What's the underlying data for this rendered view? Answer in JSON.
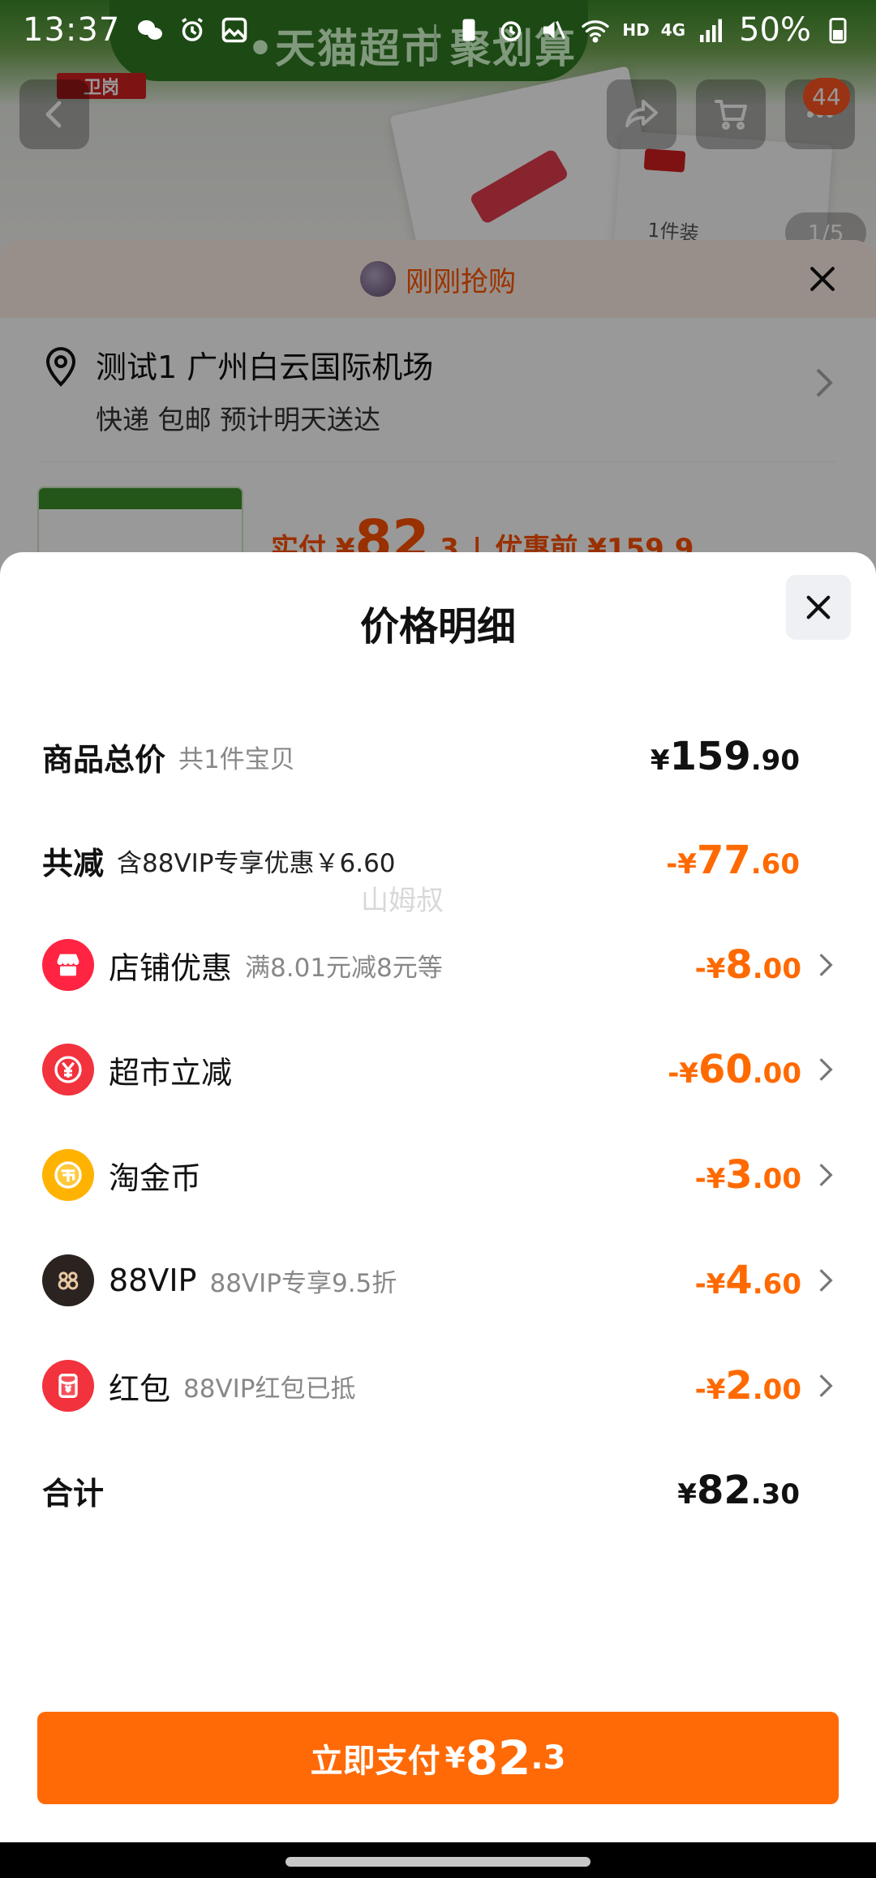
{
  "status_bar": {
    "time": "13:37",
    "hd_label": "HD",
    "network_label": "4G",
    "battery": "50%"
  },
  "background": {
    "banner_text_1": "•天猫超市",
    "banner_text_2": "聚划算",
    "brand_logo": "卫岗",
    "cart_badge": "44",
    "image_counter": "1/5",
    "product_tag": "1件装",
    "sheet": {
      "header_label": "刚刚抢购",
      "address_line": "测试1 广州白云国际机场",
      "delivery_line": "快递 包邮 预计明天送达",
      "paid_label": "实付 ¥",
      "paid_int": "82",
      "paid_dec": ".3",
      "original_label": "优惠前 ¥159.9"
    }
  },
  "modal": {
    "title": "价格明细",
    "watermark": "山姆叔",
    "rows": {
      "total": {
        "label": "商品总价",
        "sub": "共1件宝贝",
        "cur": "¥",
        "int": "159",
        "dec": ".90"
      },
      "discount": {
        "label": "共减",
        "sub": "含88VIP专享优惠￥6.60",
        "sign": "-¥",
        "int": "77",
        "dec": ".60"
      },
      "store": {
        "label": "店铺优惠",
        "sub": "满8.01元减8元等",
        "sign": "-¥",
        "int": "8",
        "dec": ".00",
        "icon": "store-icon",
        "color": "#ff2442"
      },
      "supermarket": {
        "label": "超市立减",
        "sign": "-¥",
        "int": "60",
        "dec": ".00",
        "icon": "yen-coin-icon",
        "color": "#f2323d"
      },
      "taojinbi": {
        "label": "淘金币",
        "sign": "-¥",
        "int": "3",
        "dec": ".00",
        "icon": "gold-coin-icon",
        "color": "#ffb300"
      },
      "vip": {
        "label": "88VIP",
        "sub": "88VIP专享9.5折",
        "sign": "-¥",
        "int": "4",
        "dec": ".60",
        "icon": "88vip-icon",
        "color": "#2a2320"
      },
      "redpacket": {
        "label": "红包",
        "sub": "88VIP红包已抵",
        "sign": "-¥",
        "int": "2",
        "dec": ".00",
        "icon": "red-packet-icon",
        "color": "#f2323d"
      },
      "sum": {
        "label": "合计",
        "cur": "¥",
        "int": "82",
        "dec": ".30"
      }
    },
    "pay_button": {
      "label": "立即支付",
      "cur": "¥",
      "int": "82",
      "dec": ".3"
    }
  },
  "colors": {
    "accent_orange": "#ff6a07",
    "discount_orange": "#ff6a00",
    "text_dark": "#111111",
    "text_muted": "#888888"
  }
}
